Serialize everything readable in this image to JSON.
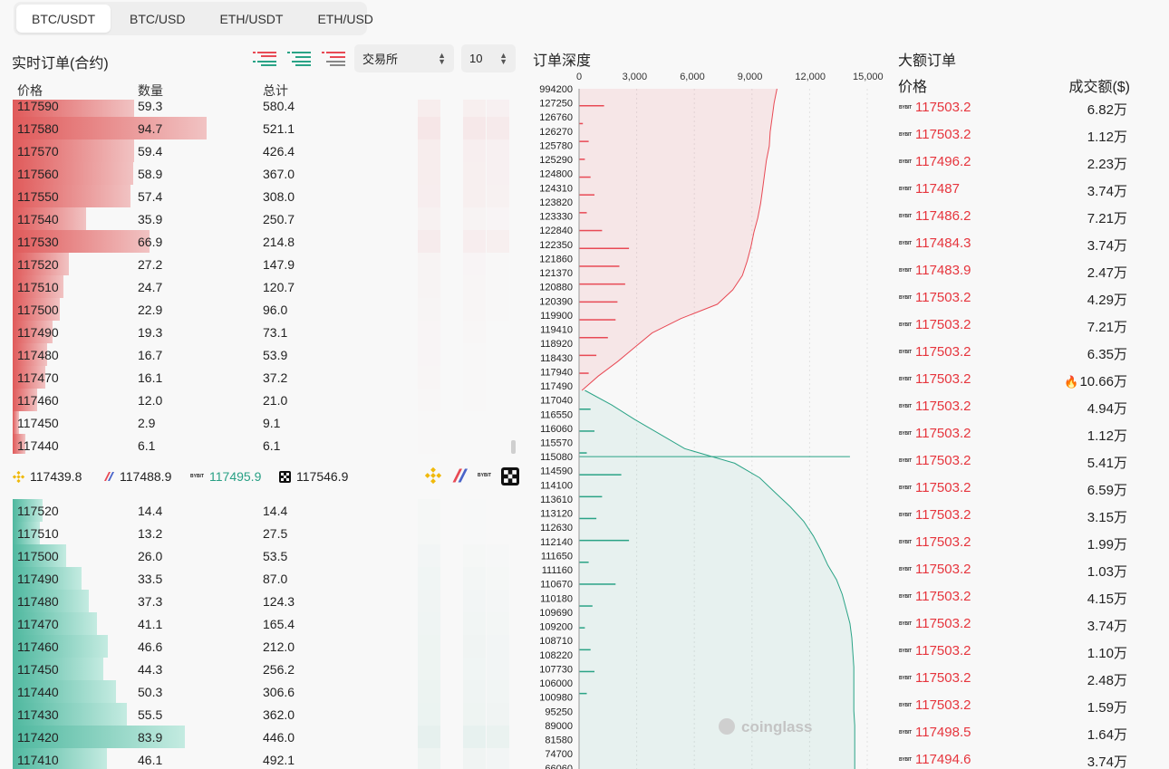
{
  "tabs": [
    "BTC/USDT",
    "BTC/USD",
    "ETH/USDT",
    "ETH/USD"
  ],
  "orderbook": {
    "title": "实时订单(合约)",
    "exchange_select": "交易所",
    "depth_select": "10",
    "headers": {
      "price": "价格",
      "qty": "数量",
      "total": "总计"
    },
    "asks": [
      {
        "p": "117590",
        "q": "59.3",
        "t": "580.4"
      },
      {
        "p": "117580",
        "q": "94.7",
        "t": "521.1"
      },
      {
        "p": "117570",
        "q": "59.4",
        "t": "426.4"
      },
      {
        "p": "117560",
        "q": "58.9",
        "t": "367.0"
      },
      {
        "p": "117550",
        "q": "57.4",
        "t": "308.0"
      },
      {
        "p": "117540",
        "q": "35.9",
        "t": "250.7"
      },
      {
        "p": "117530",
        "q": "66.9",
        "t": "214.8"
      },
      {
        "p": "117520",
        "q": "27.2",
        "t": "147.9"
      },
      {
        "p": "117510",
        "q": "24.7",
        "t": "120.7"
      },
      {
        "p": "117500",
        "q": "22.9",
        "t": "96.0"
      },
      {
        "p": "117490",
        "q": "19.3",
        "t": "73.1"
      },
      {
        "p": "117480",
        "q": "16.7",
        "t": "53.9"
      },
      {
        "p": "117470",
        "q": "16.1",
        "t": "37.2"
      },
      {
        "p": "117460",
        "q": "12.0",
        "t": "21.0"
      },
      {
        "p": "117450",
        "q": "2.9",
        "t": "9.1"
      },
      {
        "p": "117440",
        "q": "6.1",
        "t": "6.1"
      }
    ],
    "bids": [
      {
        "p": "117520",
        "q": "14.4",
        "t": "14.4"
      },
      {
        "p": "117510",
        "q": "13.2",
        "t": "27.5"
      },
      {
        "p": "117500",
        "q": "26.0",
        "t": "53.5"
      },
      {
        "p": "117490",
        "q": "33.5",
        "t": "87.0"
      },
      {
        "p": "117480",
        "q": "37.3",
        "t": "124.3"
      },
      {
        "p": "117470",
        "q": "41.1",
        "t": "165.4"
      },
      {
        "p": "117460",
        "q": "46.6",
        "t": "212.0"
      },
      {
        "p": "117450",
        "q": "44.3",
        "t": "256.2"
      },
      {
        "p": "117440",
        "q": "50.3",
        "t": "306.6"
      },
      {
        "p": "117430",
        "q": "55.5",
        "t": "362.0"
      },
      {
        "p": "117420",
        "q": "83.9",
        "t": "446.0"
      },
      {
        "p": "117410",
        "q": "46.1",
        "t": "492.1"
      }
    ],
    "exchange_prices": [
      {
        "price": "117439.8",
        "color": "#222222",
        "icon": "binance-icon"
      },
      {
        "price": "117488.9",
        "color": "#222222",
        "icon": "bitmex-icon"
      },
      {
        "price": "117495.9",
        "color": "#29a085",
        "icon": "bybit-icon",
        "label": "BYBIT"
      },
      {
        "price": "117546.9",
        "color": "#222222",
        "icon": "okx-icon"
      }
    ],
    "exchange_icon_label": "BYBIT"
  },
  "depth": {
    "title": "订单深度",
    "watermark": "coinglass"
  },
  "chart_data": {
    "type": "area",
    "title": "订单深度",
    "x_ticks": [
      "0",
      "3,000",
      "6,000",
      "9,000",
      "12,000",
      "15,000"
    ],
    "xlim": [
      0,
      15000
    ],
    "y_labels": [
      "994200",
      "127250",
      "126760",
      "126270",
      "125780",
      "125290",
      "124800",
      "124310",
      "123820",
      "123330",
      "122840",
      "122350",
      "121860",
      "121370",
      "120880",
      "120390",
      "119900",
      "119410",
      "118920",
      "118430",
      "117940",
      "117490",
      "117040",
      "116550",
      "116060",
      "115570",
      "115080",
      "114590",
      "114100",
      "113610",
      "113120",
      "112630",
      "112140",
      "111650",
      "111160",
      "110670",
      "110180",
      "109690",
      "109200",
      "108710",
      "108220",
      "107730",
      "106000",
      "100980",
      "95250",
      "89000",
      "81580",
      "74700",
      "66060"
    ],
    "ask_cumulative": [
      10300,
      10150,
      10050,
      9950,
      9900,
      9750,
      9650,
      9550,
      9450,
      9300,
      9100,
      8950,
      8750,
      8500,
      8000,
      7200,
      5300,
      3800,
      2900,
      2000,
      1000,
      150
    ],
    "bid_cumulative": [
      300,
      1700,
      2900,
      4200,
      5500,
      8100,
      9400,
      10200,
      11000,
      11700,
      12200,
      12600,
      12950,
      13400,
      13700,
      13900,
      14100,
      14200,
      14250,
      14300,
      14300,
      14300,
      14300,
      14350,
      14350,
      14350,
      14350
    ],
    "bid_spike": {
      "level": "115080",
      "value": 14100
    },
    "ask_bars": [
      1300,
      200,
      500,
      300,
      600,
      800,
      400,
      1200,
      2600,
      2100,
      2400,
      2000,
      1900,
      1500,
      900,
      500
    ],
    "bid_bars": [
      600,
      800,
      400,
      2200,
      1200,
      900,
      2600,
      500,
      1900,
      700,
      300,
      600,
      800,
      400
    ],
    "ask_color": "#e84a55",
    "bid_color": "#2aa386"
  },
  "large_orders": {
    "title": "大额订单",
    "header_price": "价格",
    "header_value": "成交额($)",
    "exchange_label": "BYBIT",
    "rows": [
      {
        "p": "117503.2",
        "v": "6.82万"
      },
      {
        "p": "117503.2",
        "v": "1.12万"
      },
      {
        "p": "117496.2",
        "v": "2.23万"
      },
      {
        "p": "117487",
        "v": "3.74万"
      },
      {
        "p": "117486.2",
        "v": "7.21万"
      },
      {
        "p": "117484.3",
        "v": "3.74万"
      },
      {
        "p": "117483.9",
        "v": "2.47万"
      },
      {
        "p": "117503.2",
        "v": "4.29万"
      },
      {
        "p": "117503.2",
        "v": "7.21万"
      },
      {
        "p": "117503.2",
        "v": "6.35万"
      },
      {
        "p": "117503.2",
        "v": "10.66万",
        "hot": true
      },
      {
        "p": "117503.2",
        "v": "4.94万"
      },
      {
        "p": "117503.2",
        "v": "1.12万"
      },
      {
        "p": "117503.2",
        "v": "5.41万"
      },
      {
        "p": "117503.2",
        "v": "6.59万"
      },
      {
        "p": "117503.2",
        "v": "3.15万"
      },
      {
        "p": "117503.2",
        "v": "1.99万"
      },
      {
        "p": "117503.2",
        "v": "1.03万"
      },
      {
        "p": "117503.2",
        "v": "4.15万"
      },
      {
        "p": "117503.2",
        "v": "3.74万"
      },
      {
        "p": "117503.2",
        "v": "1.10万"
      },
      {
        "p": "117503.2",
        "v": "2.48万"
      },
      {
        "p": "117503.2",
        "v": "1.59万"
      },
      {
        "p": "117498.5",
        "v": "1.64万"
      },
      {
        "p": "117494.6",
        "v": "3.74万"
      }
    ]
  }
}
